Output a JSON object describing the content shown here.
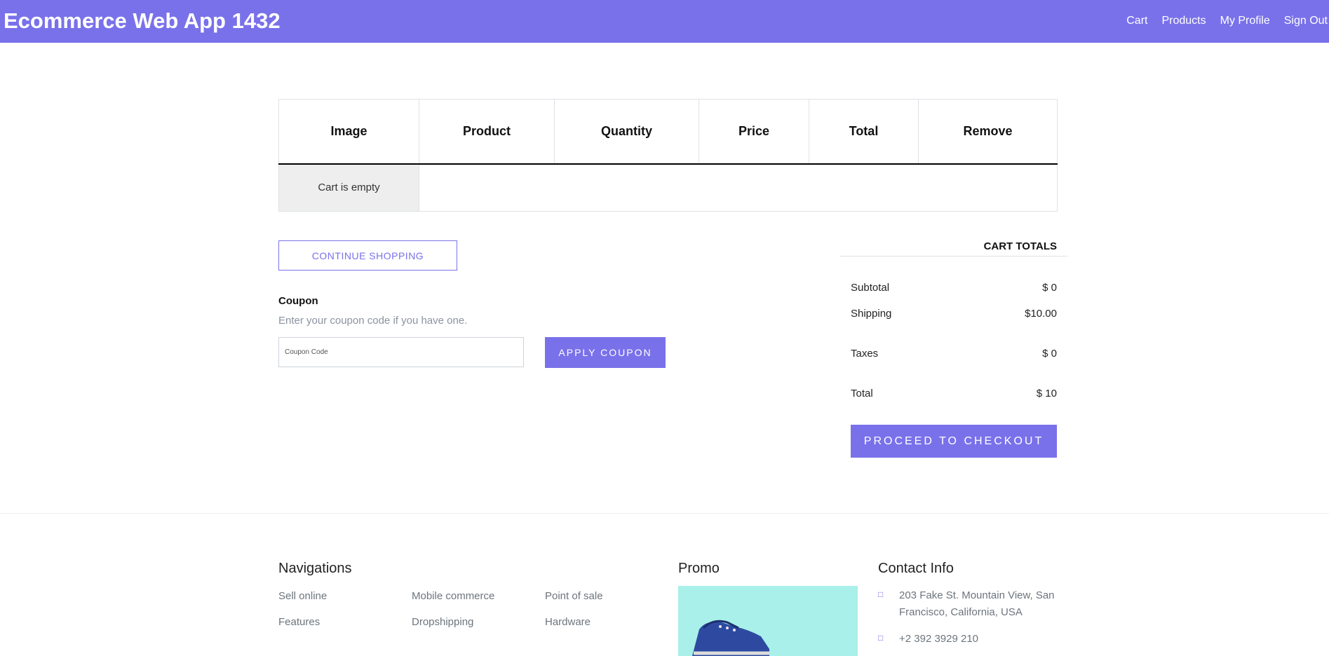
{
  "header": {
    "brand": "Ecommerce Web App 1432",
    "nav": [
      "Cart",
      "Products",
      "My Profile",
      "Sign Out"
    ]
  },
  "cart": {
    "columns": [
      "Image",
      "Product",
      "Quantity",
      "Price",
      "Total",
      "Remove"
    ],
    "empty_message": "Cart is empty"
  },
  "actions": {
    "continue_shopping": "CONTINUE SHOPPING"
  },
  "coupon": {
    "title": "Coupon",
    "description": "Enter your coupon code if you have one.",
    "placeholder": "Coupon Code",
    "apply_label": "APPLY COUPON"
  },
  "totals": {
    "title": "CART TOTALS",
    "subtotal_label": "Subtotal",
    "subtotal_value": "$ 0",
    "shipping_label": "Shipping",
    "shipping_value": "$10.00",
    "taxes_label": "Taxes",
    "taxes_value": "$ 0",
    "total_label": "Total",
    "total_value": "$ 10",
    "checkout_label": "PROCEED TO CHECKOUT"
  },
  "footer": {
    "navigations_title": "Navigations",
    "nav_col1": [
      "Sell online",
      "Features"
    ],
    "nav_col2": [
      "Mobile commerce",
      "Dropshipping"
    ],
    "nav_col3": [
      "Point of sale",
      "Hardware"
    ],
    "promo_title": "Promo",
    "contact_title": "Contact Info",
    "contact_address": "203 Fake St. Mountain View, San Francisco, California, USA",
    "contact_phone": "+2 392 3929 210"
  },
  "colors": {
    "accent": "#7971ea",
    "promo_bg": "#a8f0e9"
  }
}
